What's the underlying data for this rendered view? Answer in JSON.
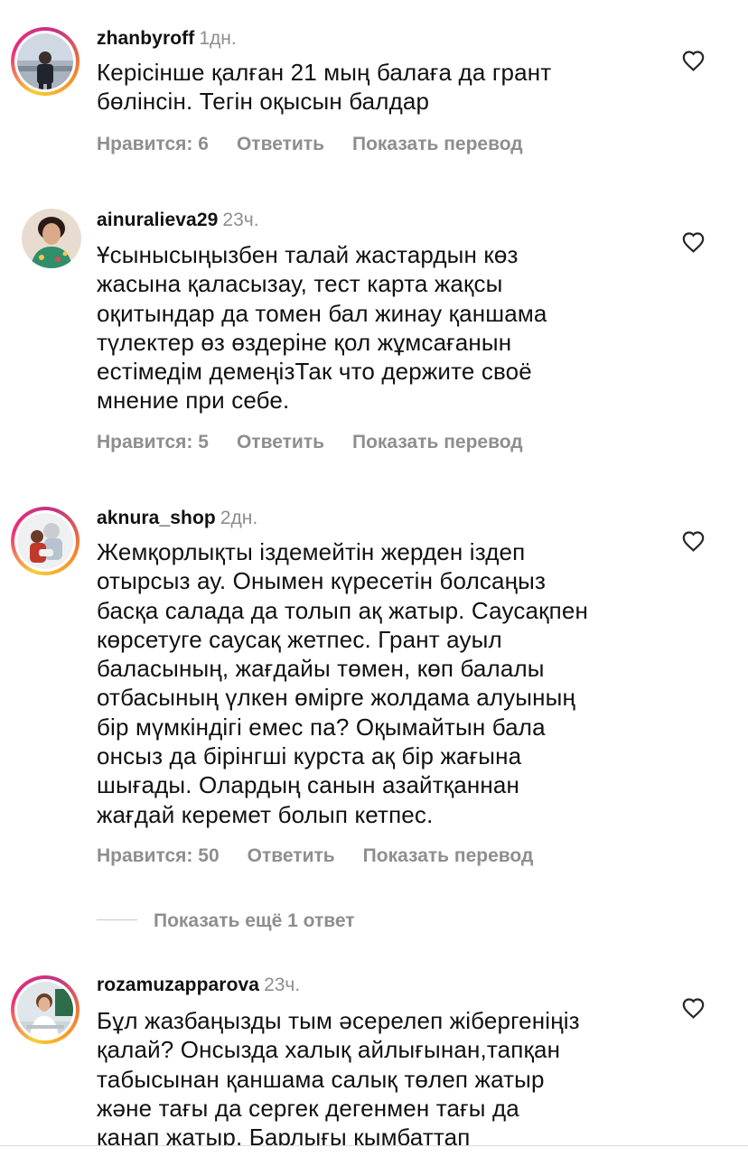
{
  "comments": [
    {
      "username": "zhanbyroff",
      "time": "1дн.",
      "text_lines": [
        "Керісінше қалған 21 мың балаға да грант",
        "бөлінсін. Тегін оқысын балдар"
      ],
      "likes": "Нравится: 6",
      "reply": "Ответить",
      "translate": "Показать перевод"
    },
    {
      "username": "ainuralieva29",
      "time": "23ч.",
      "text_lines": [
        "Ұсынысыңызбен талай жастардын көз",
        "жасына қаласызау, тест карта жақсы",
        "оқитындар да томен бал жинау қаншама",
        "түлектер өз өздеріне қол жұмсағанын",
        "естімедім демеңізТак что держите своё",
        "мнение при себе."
      ],
      "likes": "Нравится: 5",
      "reply": "Ответить",
      "translate": "Показать перевод"
    },
    {
      "username": "aknura_shop",
      "time": "2дн.",
      "text_lines": [
        "Жемқорлықты іздемейтін жерден іздеп",
        "отырсыз ау. Онымен күресетін болсаңыз",
        "басқа салада да толып ақ жатыр. Саусақпен",
        "көрсетуге саусақ жетпес. Грант ауыл",
        "баласының, жағдайы төмен, көп балалы",
        "отбасының үлкен өмірге жолдама алуының",
        "бір мүмкіндігі емес па? Оқымайтын бала",
        "онсыз да бірінгші курста ақ бір жағына",
        "шығады. Олардың санын азайтқаннан",
        "жағдай керемет болып кетпес."
      ],
      "likes": "Нравится: 50",
      "reply": "Ответить",
      "translate": "Показать перевод"
    },
    {
      "username": "rozamuzapparova",
      "time": "23ч.",
      "text_lines": [
        "Бұл жазбаңызды тым әсерелеп жібергеніңіз",
        "қалай? Онсызда халық айлығынан,тапқан",
        "табысынан қаншама салық төлеп жатыр",
        "және тағы да сергек дегенмен тағы да",
        "қанап жатыр. Барлығы қымбаттап"
      ]
    }
  ],
  "more_replies": "Показать ещё 1 ответ",
  "colors": {
    "text": "#111111",
    "muted": "#8e8e8e",
    "story_ring": "#ee2a7b"
  },
  "icons": {
    "like": "heart-outline-icon"
  }
}
